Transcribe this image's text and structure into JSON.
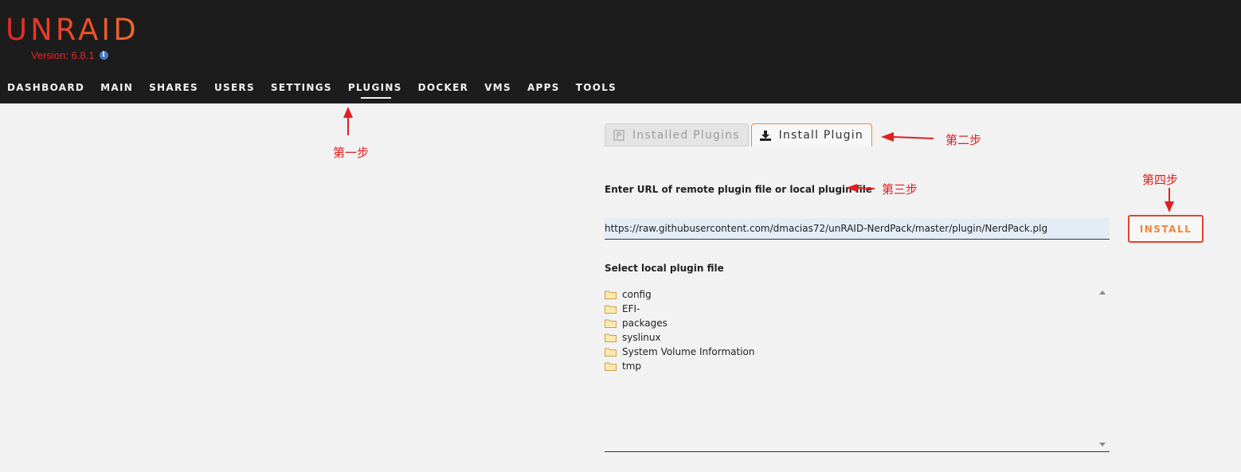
{
  "header": {
    "logo_text": "UNRAID",
    "version_text": "Version: 6.8.1",
    "info_icon_glyph": "i"
  },
  "nav": {
    "items": [
      {
        "label": "DASHBOARD"
      },
      {
        "label": "MAIN"
      },
      {
        "label": "SHARES"
      },
      {
        "label": "USERS"
      },
      {
        "label": "SETTINGS"
      },
      {
        "label": "PLUGINS",
        "active": true
      },
      {
        "label": "DOCKER"
      },
      {
        "label": "VMS"
      },
      {
        "label": "APPS"
      },
      {
        "label": "TOOLS"
      }
    ]
  },
  "tabs": {
    "installed": "Installed Plugins",
    "install": "Install Plugin"
  },
  "form": {
    "url_label": "Enter URL of remote plugin file or local plugin file",
    "url_value": "https://raw.githubusercontent.com/dmacias72/unRAID-NerdPack/master/plugin/NerdPack.plg",
    "install_button": "INSTALL",
    "local_label": "Select local plugin file"
  },
  "file_tree": {
    "items": [
      "config",
      "EFI-",
      "packages",
      "syslinux",
      "System Volume Information",
      "tmp"
    ]
  },
  "annotations": {
    "step1": "第一步",
    "step2": "第二步",
    "step3": "第三步",
    "step4": "第四步"
  },
  "colors": {
    "accent_red": "#e02020",
    "accent_orange": "#f08a3c",
    "header_bg": "#1c1c1c",
    "page_bg": "#f2f2f2"
  }
}
